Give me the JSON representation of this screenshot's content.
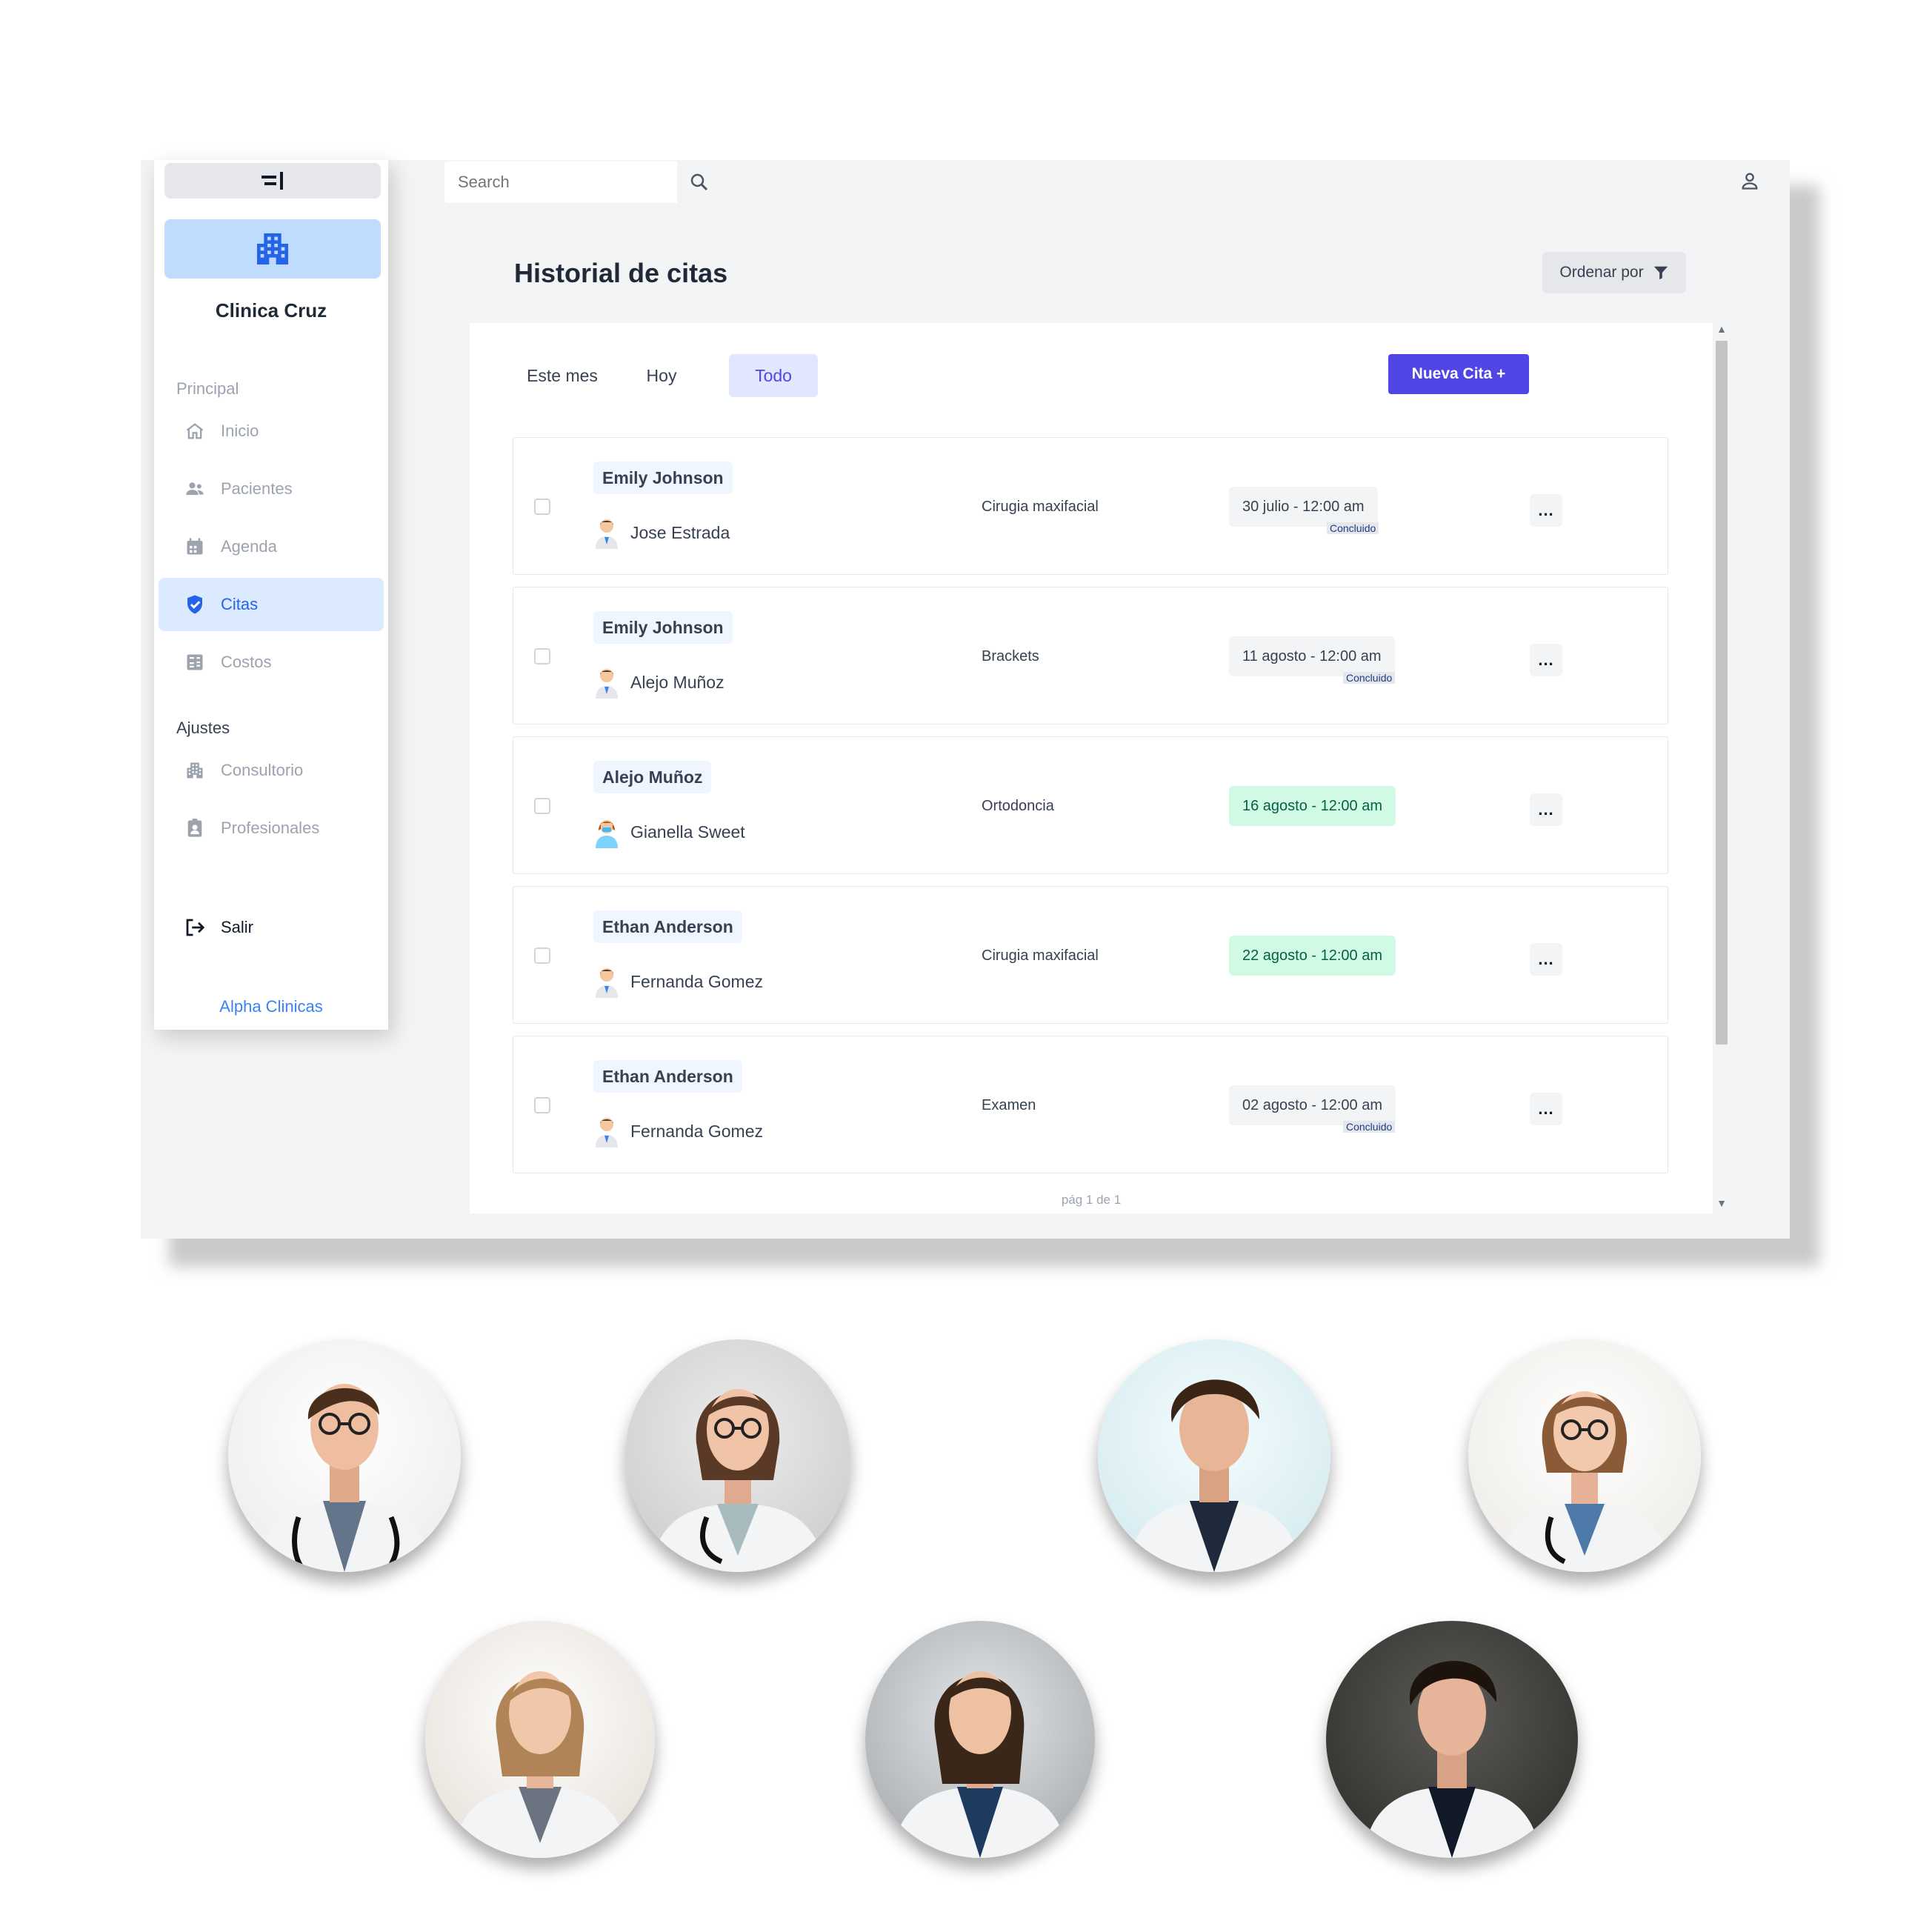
{
  "sidebar": {
    "clinic_name": "Clinica Cruz",
    "section_principal": "Principal",
    "section_ajustes": "Ajustes",
    "items": [
      {
        "label": "Inicio",
        "icon": "home-icon"
      },
      {
        "label": "Pacientes",
        "icon": "users-icon"
      },
      {
        "label": "Agenda",
        "icon": "calendar-icon"
      },
      {
        "label": "Citas",
        "icon": "appointment-check-icon",
        "active": true
      },
      {
        "label": "Costos",
        "icon": "calculator-icon"
      },
      {
        "label": "Consultorio",
        "icon": "building-icon"
      },
      {
        "label": "Profesionales",
        "icon": "id-badge-icon"
      }
    ],
    "logout_label": "Salir",
    "brand": "Alpha Clinicas"
  },
  "topbar": {
    "search_placeholder": "Search"
  },
  "page": {
    "title": "Historial de citas",
    "sort_label": "Ordenar por"
  },
  "tabs": [
    {
      "label": "Este mes"
    },
    {
      "label": "Hoy"
    },
    {
      "label": "Todo",
      "active": true
    }
  ],
  "new_button_label": "Nueva Cita +",
  "appointments": [
    {
      "patient": "Emily Johnson",
      "doctor": "Jose Estrada",
      "procedure": "Cirugia maxifacial",
      "date": "30 julio - 12:00 am",
      "status": "Concluido",
      "upcoming": false
    },
    {
      "patient": "Emily Johnson",
      "doctor": "Alejo Muñoz",
      "procedure": "Brackets",
      "date": "11 agosto - 12:00 am",
      "status": "Concluido",
      "upcoming": false
    },
    {
      "patient": "Alejo Muñoz",
      "doctor": "Gianella Sweet",
      "procedure": "Ortodoncia",
      "date": "16 agosto - 12:00 am",
      "status": "",
      "upcoming": true
    },
    {
      "patient": "Ethan Anderson",
      "doctor": "Fernanda Gomez",
      "procedure": "Cirugia maxifacial",
      "date": "22 agosto - 12:00 am",
      "status": "",
      "upcoming": true
    },
    {
      "patient": "Ethan Anderson",
      "doctor": "Fernanda Gomez",
      "procedure": "Examen",
      "date": "02 agosto - 12:00 am",
      "status": "Concluido",
      "upcoming": false
    }
  ],
  "more_label": "...",
  "pager": "pág 1 de 1",
  "colors": {
    "accent": "#4f46e5",
    "sidebar_active": "#dbeafe",
    "upcoming_bg": "#d1fae5"
  }
}
